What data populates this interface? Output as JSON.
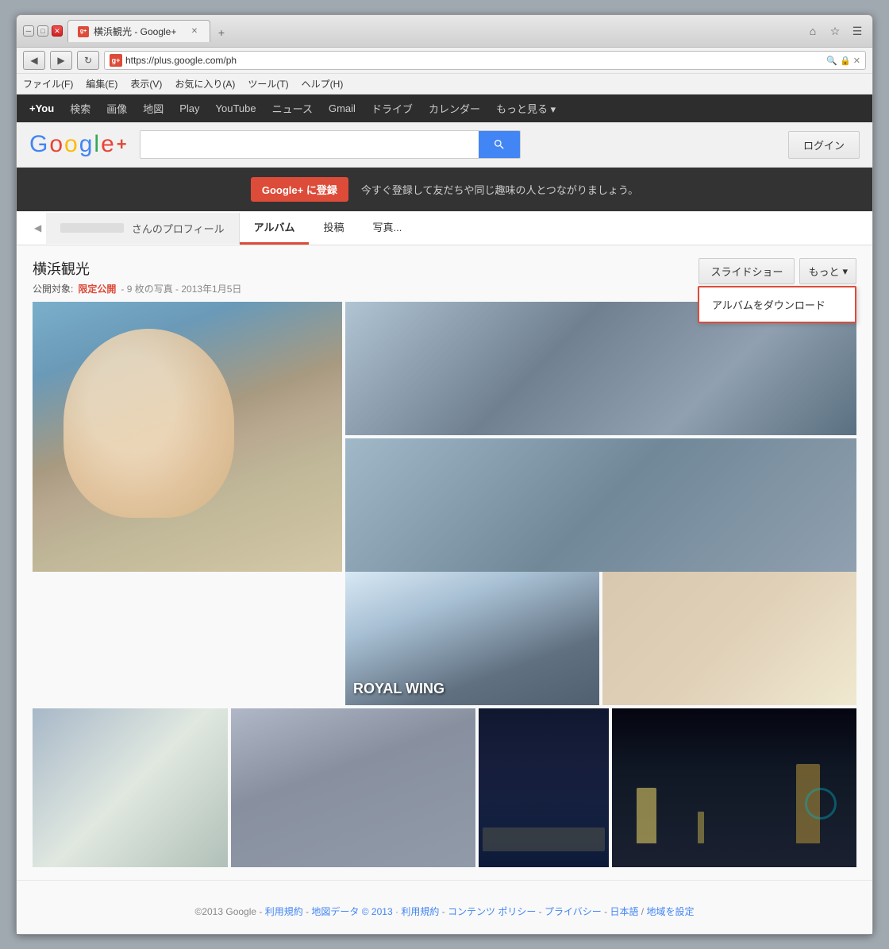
{
  "browser": {
    "title": "横浜観光 - Google+",
    "url": "https://plus.google.com/ph",
    "url_display": "https://plus.google.com/ph",
    "tab_label": "横浜観光 - Google+",
    "back_btn": "◀",
    "forward_btn": "▶",
    "reload_icon": "↻",
    "home_icon": "⌂",
    "star_icon": "☆",
    "settings_icon": "☰",
    "close_btn": "✕",
    "min_btn": "─",
    "max_btn": "□",
    "new_tab_btn": "+"
  },
  "menubar": {
    "items": [
      "ファイル(F)",
      "編集(E)",
      "表示(V)",
      "お気に入り(A)",
      "ツール(T)",
      "ヘルプ(H)"
    ]
  },
  "gplus": {
    "topnav": {
      "items": [
        "+You",
        "検索",
        "画像",
        "地図",
        "Play",
        "YouTube",
        "ニュース",
        "Gmail",
        "ドライブ",
        "カレンダー",
        "もっと見る ▾"
      ]
    },
    "header": {
      "logo": "Google+",
      "search_placeholder": "",
      "search_btn": "🔍",
      "login_btn": "ログイン"
    },
    "reg_banner": {
      "btn": "Google+ に登録",
      "text": "今すぐ登録して友だちや同じ趣味の人とつながりましょう。"
    },
    "profile_tabs": {
      "arrow": "◀",
      "name_tab": "",
      "tabs": [
        "アルバム",
        "投稿",
        "写真..."
      ]
    },
    "album": {
      "title": "横浜観光",
      "meta_label": "公開対象:",
      "meta_value": "限定公開",
      "meta_detail": "- 9 枚の写真 - 2013年1月5日",
      "slideshow_btn": "スライドショー",
      "more_btn": "もっと",
      "more_arrow": "▾",
      "download_item": "アルバムをダウンロード"
    },
    "footer": {
      "copyright": "©2013 Google",
      "links": [
        "利用規約",
        "地図データ © 2013",
        "利用規約",
        "コンテンツ ポリシー",
        "プライバシー",
        "日本語",
        "地域を設定"
      ]
    }
  }
}
